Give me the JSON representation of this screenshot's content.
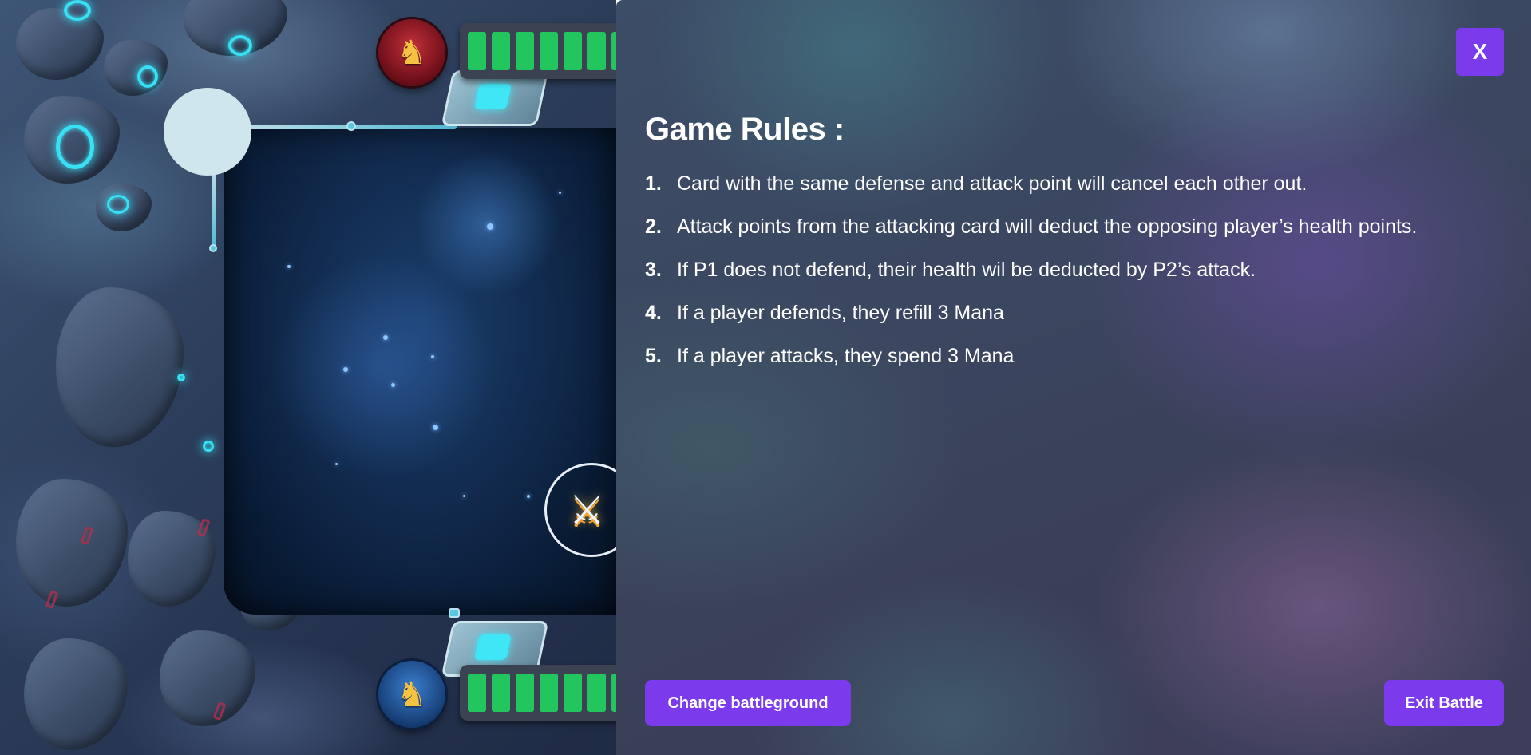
{
  "battleground": {
    "player2": {
      "avatar_icon": "red-knight-avatar-icon",
      "health_segments": 7,
      "health_color": "#22c55e"
    },
    "player1": {
      "avatar_icon": "blue-knight-avatar-icon",
      "health_segments": 7,
      "health_color": "#22c55e"
    },
    "battle_icon": "crossed-swords-icon"
  },
  "rules_panel": {
    "close_label": "X",
    "title": "Game Rules :",
    "rules": [
      {
        "num": "1.",
        "text": "Card with the same defense and attack point will cancel each other out."
      },
      {
        "num": "2.",
        "text": "Attack points from the attacking card will deduct the opposing player’s health points."
      },
      {
        "num": "3.",
        "text": "If P1 does not defend, their health wil be deducted by P2’s attack."
      },
      {
        "num": "4.",
        "text": "If a player defends, they refill 3 Mana"
      },
      {
        "num": "5.",
        "text": "If a player attacks, they spend 3 Mana"
      }
    ],
    "change_battleground_label": "Change battleground",
    "exit_battle_label": "Exit Battle"
  },
  "colors": {
    "accent": "#7c3aed",
    "health": "#22c55e",
    "text": "#ffffff"
  }
}
